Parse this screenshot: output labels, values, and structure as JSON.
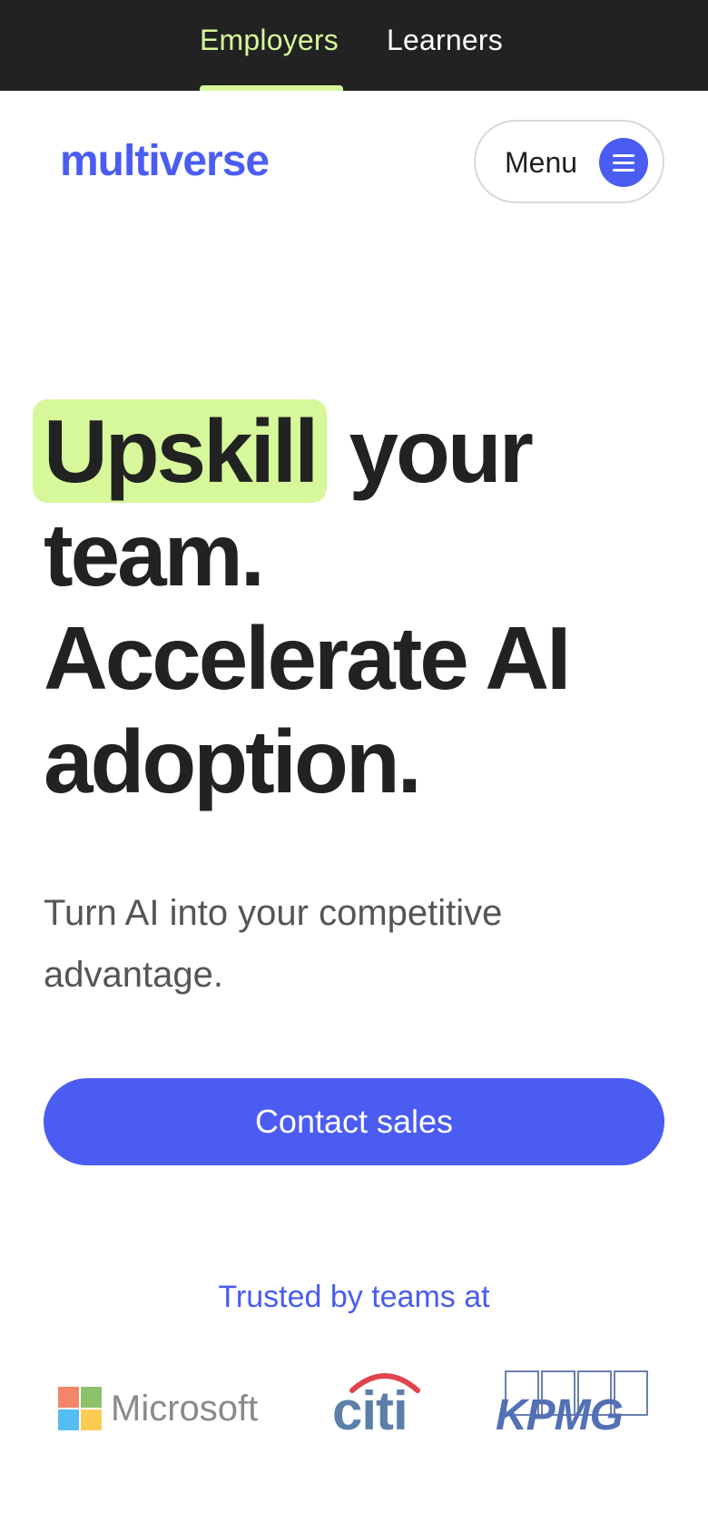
{
  "topnav": {
    "tabs": [
      {
        "label": "Employers",
        "active": true
      },
      {
        "label": "Learners",
        "active": false
      }
    ]
  },
  "header": {
    "logo_text": "multiverse",
    "menu_label": "Menu"
  },
  "hero": {
    "highlight_word": "Upskill",
    "line1_rest": " your",
    "line2": "team.",
    "line3": "Accelerate AI",
    "line4": "adoption.",
    "subtitle": "Turn AI into your competitive advantage."
  },
  "cta": {
    "label": "Contact sales"
  },
  "trusted": {
    "heading": "Trusted by teams at",
    "logos": [
      {
        "name": "Microsoft",
        "icon": "microsoft-logo"
      },
      {
        "name": "citi",
        "icon": "citi-logo"
      },
      {
        "name": "KPMG",
        "icon": "kpmg-logo"
      }
    ]
  },
  "colors": {
    "brand_blue": "#4a5cf2",
    "highlight_green": "#d6f89a",
    "topbar_bg": "#222222",
    "text_dark": "#222222",
    "text_muted": "#555555"
  }
}
